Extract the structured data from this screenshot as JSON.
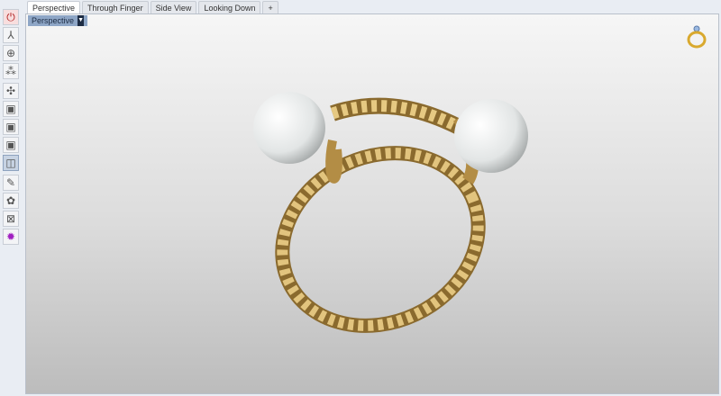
{
  "tabs": [
    {
      "label": "Perspective",
      "active": true
    },
    {
      "label": "Through Finger"
    },
    {
      "label": "Side View"
    },
    {
      "label": "Looking Down"
    },
    {
      "label": "+"
    }
  ],
  "viewport": {
    "label": "Perspective"
  },
  "toolbar": {
    "icons": [
      "power-icon",
      "axes-icon",
      "globe-icon",
      "nodes-icon",
      "axis-arrows-icon",
      "box-front-icon",
      "box-side-icon",
      "box-top-icon",
      "box-perspective-icon",
      "brush-icon",
      "paint-icon",
      "zoom-extents-icon",
      "gear-icon"
    ]
  },
  "colors": {
    "gold": "#c9a45a",
    "pearl": "#eef0f0",
    "accent": "#8ea6c6"
  }
}
